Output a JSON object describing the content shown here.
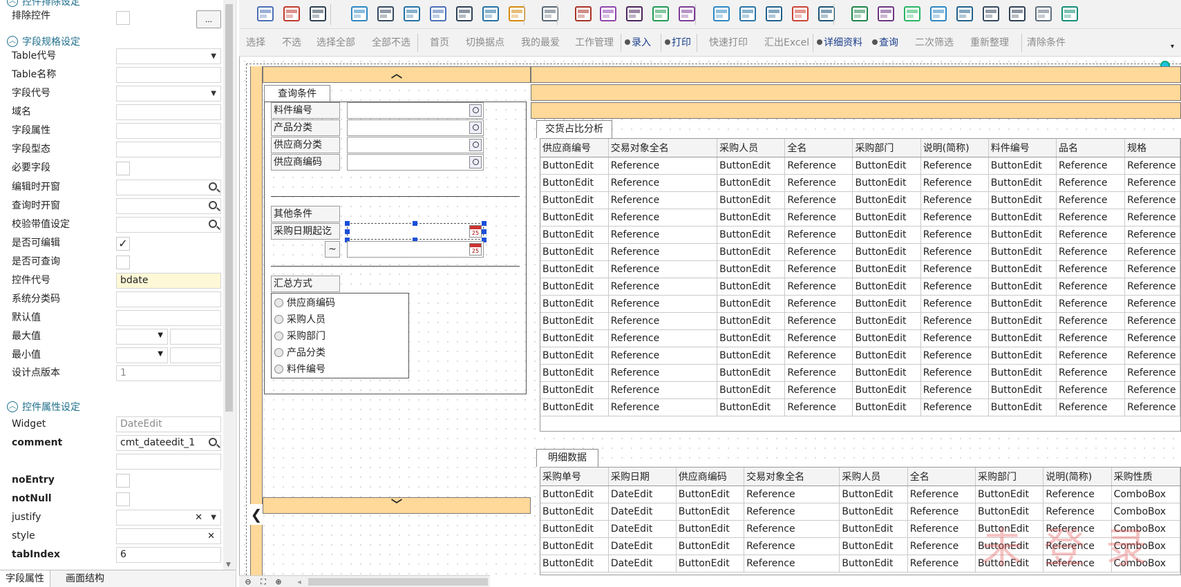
{
  "left_panel": {
    "sections": [
      {
        "title": "控件排除设定"
      },
      {
        "title": "字段规格设定"
      },
      {
        "title": "控件属性设定"
      }
    ],
    "exclude_label": "排除控件",
    "ellipsis_label": "...",
    "field_rows": [
      {
        "label": "Table代号",
        "type": "select",
        "value": ""
      },
      {
        "label": "Table名称",
        "type": "text",
        "value": ""
      },
      {
        "label": "字段代号",
        "type": "select",
        "value": ""
      },
      {
        "label": "域名",
        "type": "text",
        "value": ""
      },
      {
        "label": "字段属性",
        "type": "text",
        "value": ""
      },
      {
        "label": "字段型态",
        "type": "text",
        "value": ""
      },
      {
        "label": "必要字段",
        "type": "checkbox",
        "checked": false
      },
      {
        "label": "编辑时开窗",
        "type": "search",
        "value": ""
      },
      {
        "label": "查询时开窗",
        "type": "search",
        "value": ""
      },
      {
        "label": "校验带值设定",
        "type": "search",
        "value": ""
      },
      {
        "label": "是否可编辑",
        "type": "checkbox",
        "checked": true
      },
      {
        "label": "是否可查询",
        "type": "checkbox",
        "checked": false
      },
      {
        "label": "控件代号",
        "type": "text",
        "value": "bdate",
        "highlight": true
      },
      {
        "label": "系统分类码",
        "type": "text",
        "value": ""
      },
      {
        "label": "默认值",
        "type": "text",
        "value": ""
      },
      {
        "label": "最大值",
        "type": "split",
        "value": ""
      },
      {
        "label": "最小值",
        "type": "split",
        "value": ""
      },
      {
        "label": "设计点版本",
        "type": "text",
        "value": "1",
        "gray": true
      }
    ],
    "control_rows": [
      {
        "label": "Widget",
        "type": "text",
        "value": "DateEdit",
        "gray": true,
        "bold": false
      },
      {
        "label": "comment",
        "type": "search",
        "value": "cmt_dateedit_1",
        "bold": true
      },
      {
        "label": "",
        "type": "text",
        "value": "",
        "bold": false
      },
      {
        "label": "noEntry",
        "type": "checkbox",
        "checked": false,
        "bold": true
      },
      {
        "label": "notNull",
        "type": "checkbox",
        "checked": false,
        "bold": true
      },
      {
        "label": "justify",
        "type": "clearselect",
        "value": "",
        "bold": false
      },
      {
        "label": "style",
        "type": "clear",
        "value": "",
        "bold": false
      },
      {
        "label": "tabIndex",
        "type": "text",
        "value": "6",
        "bold": true
      }
    ],
    "bottom_tabs": [
      "字段属性",
      "画面结构"
    ]
  },
  "toolbar2": {
    "buttons": [
      {
        "label": "选择",
        "on": false,
        "bulb": false
      },
      {
        "label": "不选",
        "on": false,
        "bulb": false
      },
      {
        "label": "选择全部",
        "on": false,
        "bulb": false
      },
      {
        "label": "全部不选",
        "on": false,
        "bulb": false
      },
      {
        "label": "首页",
        "on": false,
        "bulb": false
      },
      {
        "label": "切换据点",
        "on": false,
        "bulb": false
      },
      {
        "label": "我的最爱",
        "on": false,
        "bulb": false
      },
      {
        "label": "工作管理",
        "on": false,
        "bulb": false
      },
      {
        "label": "录入",
        "on": true,
        "bulb": true
      },
      {
        "label": "打印",
        "on": true,
        "bulb": true
      },
      {
        "label": "快速打印",
        "on": false,
        "bulb": false
      },
      {
        "label": "汇出Excel",
        "on": false,
        "bulb": false
      },
      {
        "label": "详细资料",
        "on": true,
        "bulb": true
      },
      {
        "label": "查询",
        "on": true,
        "bulb": true
      },
      {
        "label": "二次筛选",
        "on": false,
        "bulb": false
      },
      {
        "label": "重新整理",
        "on": false,
        "bulb": false
      },
      {
        "label": "清除条件",
        "on": false,
        "bulb": false
      }
    ]
  },
  "query": {
    "tab_label": "查询条件",
    "fields": [
      "料件编号",
      "产品分类",
      "供应商分类",
      "供应商编码"
    ],
    "other_label": "其他条件",
    "date_label": "采购日期起讫",
    "tilde": "~",
    "summary_label": "汇总方式",
    "radios": [
      "供应商编码",
      "采购人员",
      "采购部门",
      "产品分类",
      "料件编号"
    ]
  },
  "grid1": {
    "tab_label": "交货占比分析",
    "columns": [
      "供应商编号",
      "交易对象全名",
      "采购人员",
      "全名",
      "采购部门",
      "说明(简称)",
      "料件编号",
      "品名",
      "规格"
    ],
    "row_template": [
      "ButtonEdit",
      "Reference",
      "ButtonEdit",
      "Reference",
      "ButtonEdit",
      "Reference",
      "ButtonEdit",
      "Reference",
      "Reference"
    ],
    "row_count": 15
  },
  "grid2": {
    "tab_label": "明细数据",
    "columns": [
      "采购单号",
      "采购日期",
      "供应商编码",
      "交易对象全名",
      "采购人员",
      "全名",
      "采购部门",
      "说明(简称)",
      "采购性质"
    ],
    "row_template": [
      "ButtonEdit",
      "DateEdit",
      "ButtonEdit",
      "Reference",
      "ButtonEdit",
      "Reference",
      "ButtonEdit",
      "Reference",
      "ComboBox"
    ],
    "row_count": 5
  },
  "watermark": "未登录",
  "icons": [
    "window-icon",
    "language-icon",
    "binoculars-icon",
    "numpad-icon",
    "form-icon",
    "grid-icon",
    "panel-icon",
    "split-icon",
    "table-icon",
    "tree-icon",
    "database-icon",
    "ok-button-icon",
    "image-edit-icon",
    "ruler-icon",
    "picture-icon",
    "label-icon",
    "textbox-icon",
    "checklist-icon",
    "combobox-icon",
    "calendar-icon",
    "input-icon",
    "image-icon",
    "label2-icon",
    "progress-icon",
    "option-icon",
    "slider-icon",
    "spin-icon",
    "scroll-icon",
    "clock-icon",
    "globe-icon"
  ]
}
